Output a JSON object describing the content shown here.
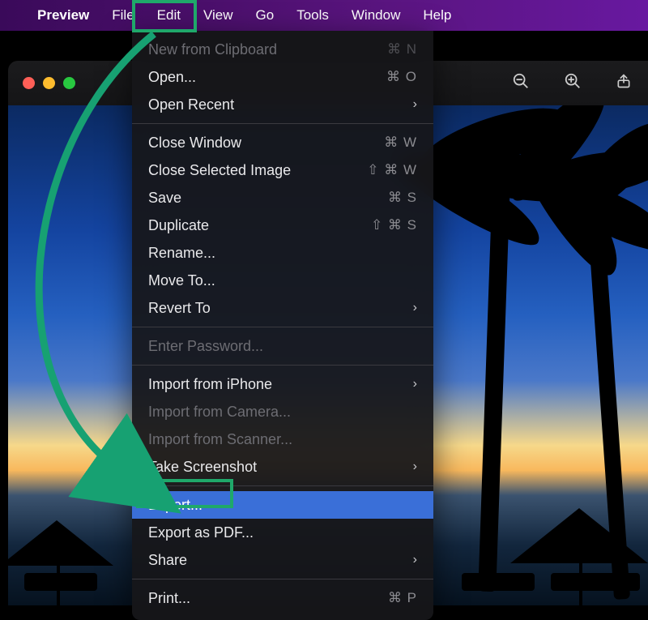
{
  "menubar": {
    "app": "Preview",
    "items": [
      "File",
      "Edit",
      "View",
      "Go",
      "Tools",
      "Window",
      "Help"
    ]
  },
  "dropdown": {
    "groups": [
      [
        {
          "label": "New from Clipboard",
          "shortcut": "⌘ N",
          "disabled": true
        },
        {
          "label": "Open...",
          "shortcut": "⌘ O"
        },
        {
          "label": "Open Recent",
          "submenu": true
        }
      ],
      [
        {
          "label": "Close Window",
          "shortcut": "⌘ W"
        },
        {
          "label": "Close Selected Image",
          "shortcut": "⇧ ⌘ W"
        },
        {
          "label": "Save",
          "shortcut": "⌘ S"
        },
        {
          "label": "Duplicate",
          "shortcut": "⇧ ⌘ S"
        },
        {
          "label": "Rename..."
        },
        {
          "label": "Move To..."
        },
        {
          "label": "Revert To",
          "submenu": true
        }
      ],
      [
        {
          "label": "Enter Password...",
          "disabled": true
        }
      ],
      [
        {
          "label": "Import from iPhone",
          "submenu": true
        },
        {
          "label": "Import from Camera...",
          "disabled": true
        },
        {
          "label": "Import from Scanner...",
          "disabled": true
        },
        {
          "label": "Take Screenshot",
          "submenu": true
        }
      ],
      [
        {
          "label": "Export...",
          "highlighted": true
        },
        {
          "label": "Export as PDF..."
        },
        {
          "label": "Share",
          "submenu": true
        }
      ],
      [
        {
          "label": "Print...",
          "shortcut": "⌘ P"
        }
      ]
    ]
  },
  "annotations": {
    "highlight_color": "#1fa86a",
    "from": "File",
    "to": "Export..."
  }
}
